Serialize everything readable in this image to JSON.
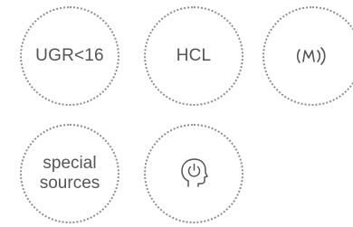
{
  "badges": [
    {
      "label": "UGR<16"
    },
    {
      "label": "HCL"
    },
    {
      "icon": "sensor-icon"
    },
    {
      "label_lines": [
        "special",
        "sources"
      ]
    },
    {
      "icon": "head-power-icon"
    }
  ],
  "colors": {
    "dots": "#8e8e8e",
    "text": "#555555"
  }
}
